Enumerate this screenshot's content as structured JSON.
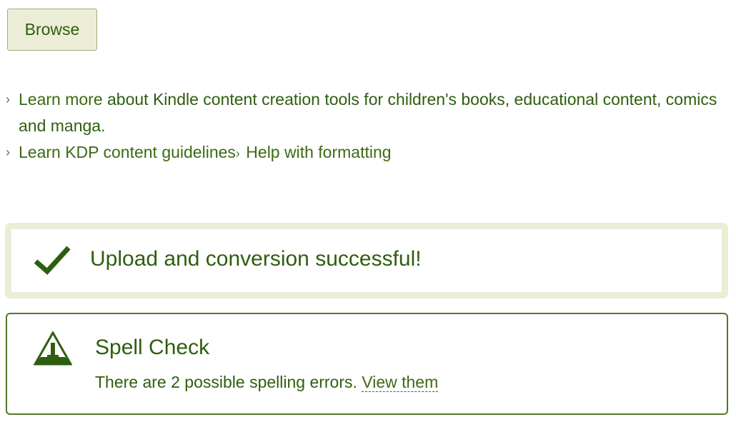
{
  "upload": {
    "browse_label": "Browse"
  },
  "links": {
    "learn_more_prefix": "Learn more ",
    "learn_more_text": "about Kindle content creation tools for children's books, educational content, comics and manga.",
    "guidelines_label": "Learn KDP content guidelines",
    "help_label": "Help with formatting"
  },
  "success": {
    "message": "Upload and conversion successful!",
    "icon": "checkmark-icon"
  },
  "spell_check": {
    "title": "Spell Check",
    "message": "There are 2 possible spelling errors. ",
    "link_label": "View them",
    "icon": "warning-icon"
  },
  "colors": {
    "text": "#2e5e0f",
    "box_border": "#ecedd7",
    "spell_border": "#4f7a28"
  }
}
